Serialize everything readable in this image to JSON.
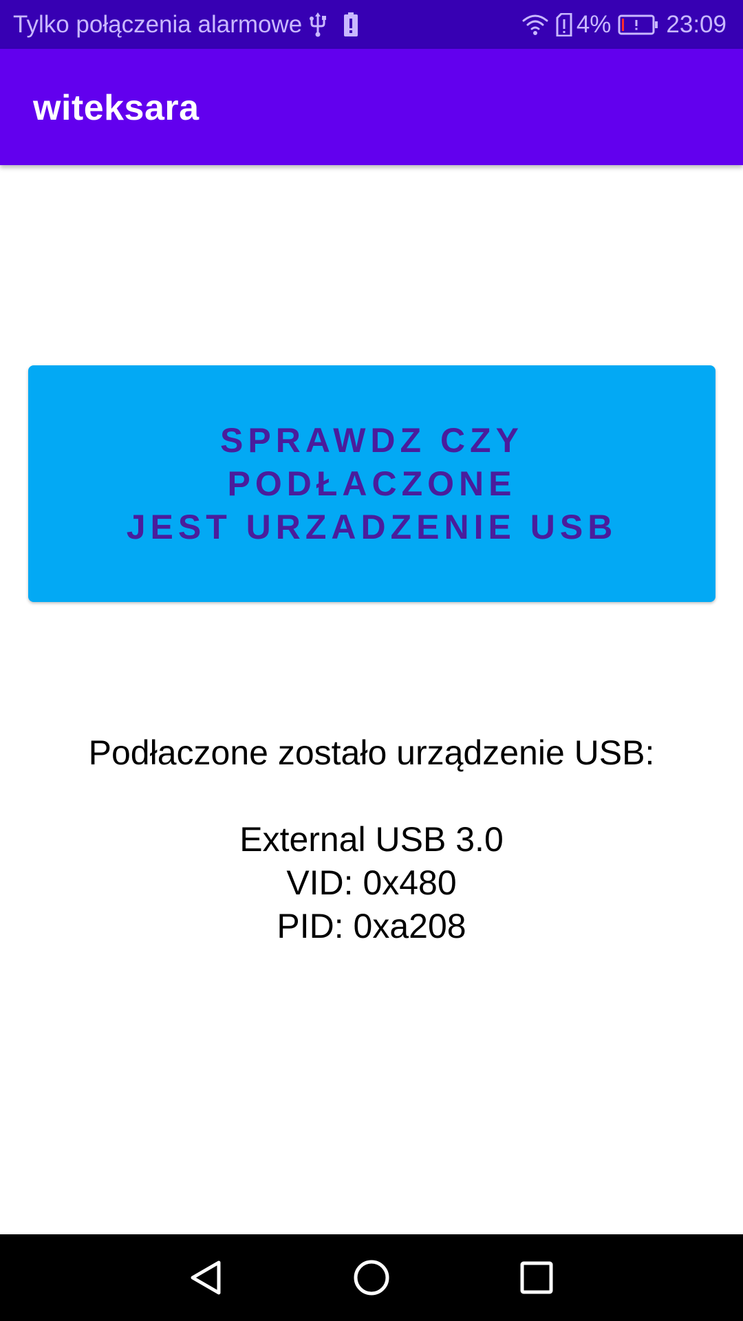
{
  "status_bar": {
    "carrier_text": "Tylko połączenia alarmowe",
    "battery_percent": "4%",
    "time": "23:09",
    "icons": [
      "usb-icon",
      "battery-alert-icon",
      "wifi-icon",
      "sim-alert-icon",
      "battery-low-icon"
    ],
    "background_color": "#3700b3"
  },
  "app_bar": {
    "title": "witeksara",
    "background_color": "#6200ee"
  },
  "main": {
    "check_button": {
      "line1": "SPRAWDZ CZY PODŁACZONE",
      "line2": "JEST URZADZENIE USB",
      "background_color": "#03a9f4",
      "text_color": "#4a1d9c"
    },
    "result": {
      "heading": "Podłaczone zostało urządzenie USB:",
      "device_name": "External USB 3.0",
      "vid": "VID: 0x480",
      "pid": "PID: 0xa208"
    }
  },
  "nav_bar": {
    "buttons": [
      "back-icon",
      "home-icon",
      "recents-icon"
    ]
  }
}
